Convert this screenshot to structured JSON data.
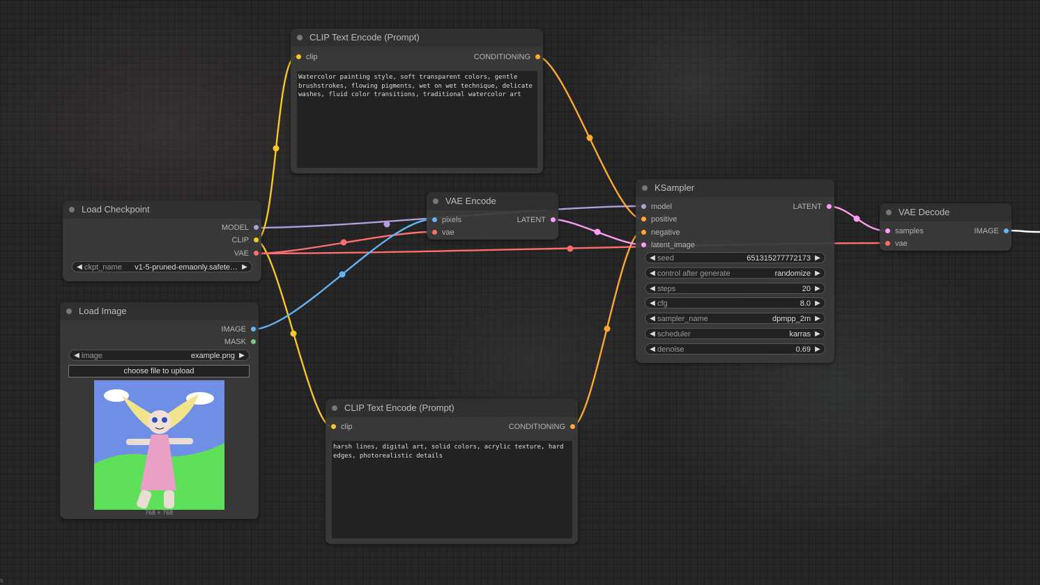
{
  "colors": {
    "model": "#b39ddb",
    "clip": "#f6c928",
    "vae": "#ff6e6e",
    "conditioning": "#ffa931",
    "latent": "#ff9cf9",
    "image": "#64b5f6",
    "mask": "#81c784"
  },
  "nodes": {
    "clip_pos": {
      "title": "CLIP Text Encode (Prompt)",
      "input_clip": "clip",
      "output_conditioning": "CONDITIONING",
      "text": "Watercolor painting style, soft transparent colors, gentle brushstrokes, flowing pigments, wet on wet technique, delicate washes, fluid color transitions, traditional watercolor art"
    },
    "checkpoint": {
      "title": "Load Checkpoint",
      "output_model": "MODEL",
      "output_clip": "CLIP",
      "output_vae": "VAE",
      "ckpt_label": "ckpt_name",
      "ckpt_value": "v1-5-pruned-emaonly.safete…"
    },
    "vae_encode": {
      "title": "VAE Encode",
      "input_pixels": "pixels",
      "input_vae": "vae",
      "output_latent": "LATENT"
    },
    "ksampler": {
      "title": "KSampler",
      "input_model": "model",
      "input_positive": "positive",
      "input_negative": "negative",
      "input_latent": "latent_image",
      "output_latent": "LATENT",
      "widgets": [
        {
          "label": "seed",
          "value": "651315277772173"
        },
        {
          "label": "control after generate",
          "value": "randomize"
        },
        {
          "label": "steps",
          "value": "20"
        },
        {
          "label": "cfg",
          "value": "8.0"
        },
        {
          "label": "sampler_name",
          "value": "dpmpp_2m"
        },
        {
          "label": "scheduler",
          "value": "karras"
        },
        {
          "label": "denoise",
          "value": "0.69"
        }
      ]
    },
    "vae_decode": {
      "title": "VAE Decode",
      "input_samples": "samples",
      "input_vae": "vae",
      "output_image": "IMAGE"
    },
    "load_image": {
      "title": "Load Image",
      "output_image": "IMAGE",
      "output_mask": "MASK",
      "image_label": "image",
      "image_value": "example.png",
      "upload_label": "choose file to upload",
      "size_caption": "768 × 768"
    },
    "clip_neg": {
      "title": "CLIP Text Encode (Prompt)",
      "input_clip": "clip",
      "output_conditioning": "CONDITIONING",
      "text": "harsh lines, digital art, solid colors, acrylic texture, hard edges, photorealistic details"
    }
  },
  "corner_text": "s"
}
